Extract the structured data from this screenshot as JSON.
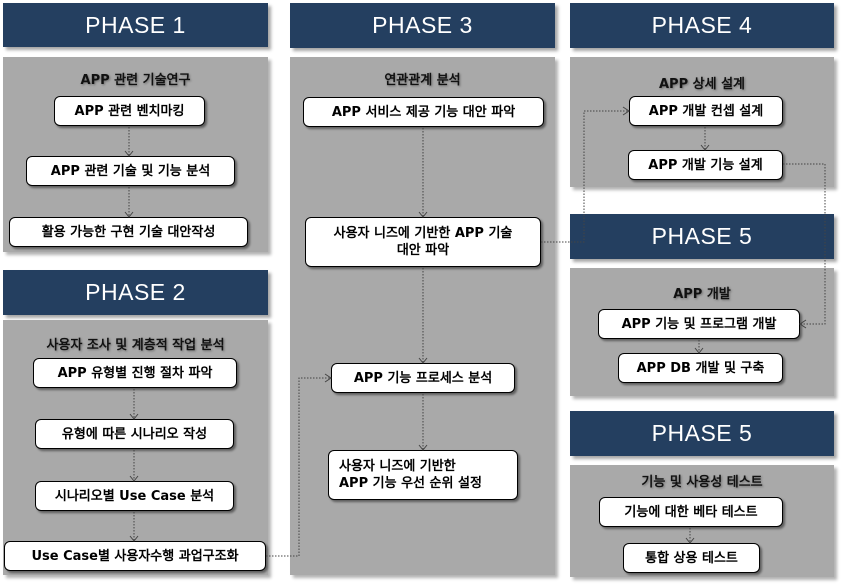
{
  "colors": {
    "header_bg": "#243f60",
    "header_text": "#ffffff",
    "panel_bg": "#a9a9a9",
    "box_bg": "#ffffff"
  },
  "phases": [
    {
      "header": "PHASE 1",
      "title": "APP 관련 기술연구",
      "steps": [
        "APP 관련 벤치마킹",
        "APP 관련 기술 및 기능 분석",
        "활용 가능한 구현 기술 대안작성"
      ]
    },
    {
      "header": "PHASE 2",
      "title": "사용자 조사 및 계층적 작업 분석",
      "steps": [
        "APP 유형별 진행 절차 파악",
        "유형에 따른 시나리오 작성",
        "시나리오별 Use Case 분석",
        "Use Case별 사용자수행 과업구조화"
      ]
    },
    {
      "header": "PHASE 3",
      "title": "연관관계 분석",
      "steps": [
        "APP 서비스 제공 기능 대안 파악",
        "사용자 니즈에 기반한 APP 기술\n대안 파악",
        "APP 기능 프로세스 분석",
        "사용자 니즈에 기반한\nAPP 기능 우선 순위 설정"
      ]
    },
    {
      "header": "PHASE 4",
      "title": "APP 상세 설계",
      "steps": [
        "APP 개발 컨셉 설계",
        "APP 개발 기능 설계"
      ]
    },
    {
      "header": "PHASE 5",
      "title": "APP 개발",
      "steps": [
        "APP 기능 및 프로그램 개발",
        "APP DB 개발 및 구축"
      ]
    },
    {
      "header": "PHASE 5",
      "title": "기능 및 사용성 테스트",
      "steps": [
        "기능에 대한 베타 테스트",
        "통합 상용 테스트"
      ]
    }
  ]
}
